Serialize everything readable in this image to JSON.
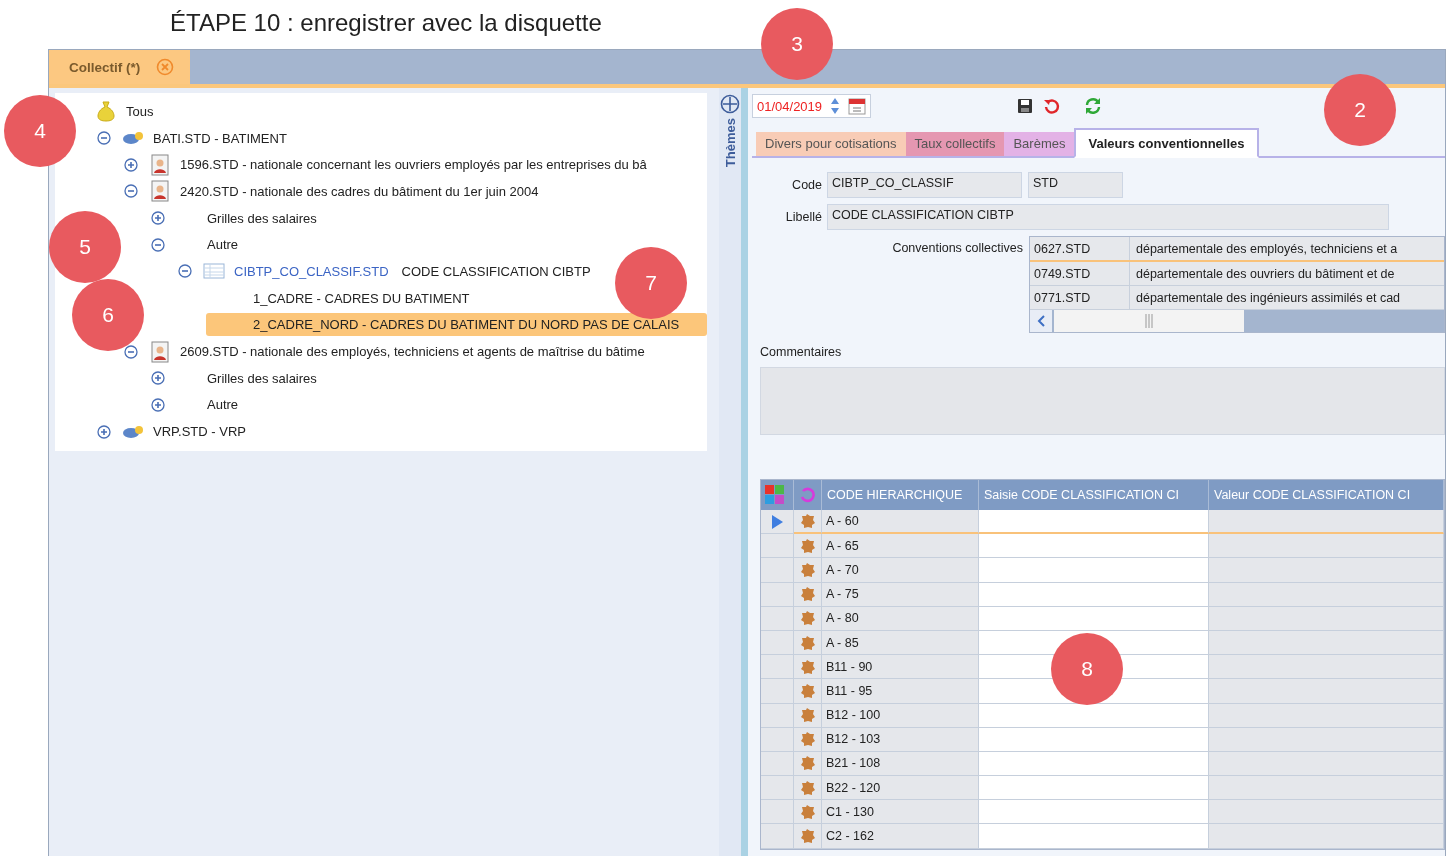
{
  "heading": "ÉTAPE 10 : enregistrer avec la disquette",
  "document_tab": {
    "label": "Collectif (*)"
  },
  "tree": [
    {
      "kind": "root",
      "label": "Tous",
      "selected": false,
      "children": [
        {
          "kind": "group",
          "label": "BATI.STD - BATIMENT",
          "expanded": true,
          "selected": false,
          "children": [
            {
              "kind": "convention",
              "label": "1596.STD - nationale concernant les ouvriers employés par les entreprises du bâ",
              "expanded": false,
              "selected": false
            },
            {
              "kind": "convention",
              "label": "2420.STD - nationale des cadres du bâtiment du 1er juin 2004",
              "expanded": true,
              "selected": false,
              "children": [
                {
                  "label": "Grilles des salaires",
                  "expanded": false,
                  "selected": false
                },
                {
                  "label": "Autre",
                  "expanded": true,
                  "selected": false,
                  "children": [
                    {
                      "kind": "table",
                      "code": "CIBTP_CO_CLASSIF.STD",
                      "label": "CODE CLASSIFICATION CIBTP",
                      "expanded": true,
                      "selected": false,
                      "children": [
                        {
                          "kind": "item",
                          "label": "1_CADRE - CADRES DU BATIMENT",
                          "selected": false
                        },
                        {
                          "kind": "item",
                          "label": "2_CADRE_NORD - CADRES DU BATIMENT DU NORD PAS DE CALAIS",
                          "selected": true
                        }
                      ]
                    }
                  ]
                }
              ]
            },
            {
              "kind": "convention",
              "label": "2609.STD - nationale des employés, techniciens et agents de maîtrise du bâtime",
              "expanded": true,
              "selected": false,
              "children": [
                {
                  "label": "Grilles des salaires",
                  "expanded": false,
                  "selected": false
                },
                {
                  "label": "Autre",
                  "expanded": false,
                  "selected": false
                }
              ]
            }
          ]
        },
        {
          "kind": "group",
          "label": "VRP.STD - VRP",
          "expanded": false,
          "selected": false
        }
      ]
    }
  ],
  "side_panel": {
    "label": "Thèmes"
  },
  "date_field": {
    "value": "01/04/2019"
  },
  "tabs": [
    {
      "label": "Divers pour cotisations",
      "color": "#f8ccb6",
      "selected": false
    },
    {
      "label": "Taux collectifs",
      "color": "#e597b1",
      "selected": false
    },
    {
      "label": "Barèmes",
      "color": "#e3b2e6",
      "selected": false
    },
    {
      "label": "Valeurs conventionnelles",
      "color": "#ffffff",
      "selected": true
    }
  ],
  "form": {
    "code_label": "Code",
    "code": "CIBTP_CO_CLASSIF",
    "suffix": "STD",
    "libelle_label": "Libellé",
    "libelle": "CODE CLASSIFICATION CIBTP",
    "conventions_label": "Conventions collectives",
    "conventions": [
      {
        "code": "0627.STD",
        "label": "départementale des employés, techniciens et a",
        "selected": true
      },
      {
        "code": "0749.STD",
        "label": "départementale des ouvriers du bâtiment et de",
        "selected": false
      },
      {
        "code": "0771.STD",
        "label": "départementale des ingénieurs assimilés et cad",
        "selected": false
      }
    ],
    "comments_label": "Commentaires"
  },
  "grid": {
    "columns": [
      "CODE HIERARCHIQUE",
      "Saisie CODE CLASSIFICATION CI",
      "Valeur CODE CLASSIFICATION CI"
    ],
    "rows": [
      {
        "code": "A - 60",
        "selected": true
      },
      {
        "code": "A - 65",
        "selected": false
      },
      {
        "code": "A - 70",
        "selected": false
      },
      {
        "code": "A - 75",
        "selected": false
      },
      {
        "code": "A - 80",
        "selected": false
      },
      {
        "code": "A - 85",
        "selected": false
      },
      {
        "code": "B11 - 90",
        "selected": false
      },
      {
        "code": "B11 - 95",
        "selected": false
      },
      {
        "code": "B12 - 100",
        "selected": false
      },
      {
        "code": "B12 - 103",
        "selected": false
      },
      {
        "code": "B21 - 108",
        "selected": false
      },
      {
        "code": "B22 - 120",
        "selected": false
      },
      {
        "code": "C1 - 130",
        "selected": false
      },
      {
        "code": "C2 - 162",
        "selected": false
      }
    ]
  },
  "callouts": [
    {
      "number": "3"
    },
    {
      "number": "2"
    },
    {
      "number": "4"
    },
    {
      "number": "5"
    },
    {
      "number": "6"
    },
    {
      "number": "7"
    },
    {
      "number": "8"
    }
  ]
}
